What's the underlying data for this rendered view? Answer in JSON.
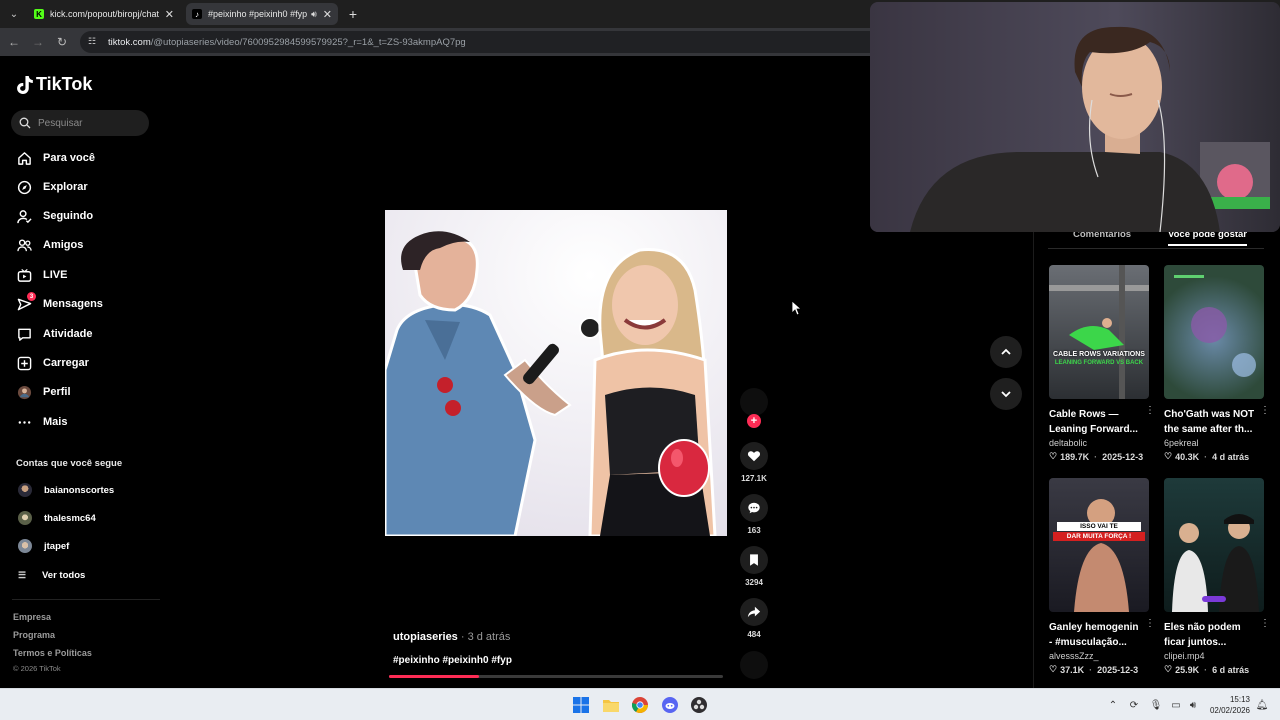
{
  "browser": {
    "tabs": [
      {
        "title": "kick.com/popout/biropj/chat",
        "active": false
      },
      {
        "title": "#peixinho #peixinh0 #fyp |",
        "active": true
      }
    ],
    "url_host": "tiktok.com",
    "url_path": "/@utopiaseries/video/7600952984599579925?_r=1&_t=ZS-93akmpAQ7pg"
  },
  "sidebar": {
    "logo": "TikTok",
    "search_placeholder": "Pesquisar",
    "nav": [
      {
        "label": "Para você",
        "icon": "home-icon"
      },
      {
        "label": "Explorar",
        "icon": "compass-icon"
      },
      {
        "label": "Seguindo",
        "icon": "person-check-icon"
      },
      {
        "label": "Amigos",
        "icon": "friends-icon"
      },
      {
        "label": "LIVE",
        "icon": "live-tv-icon"
      },
      {
        "label": "Mensagens",
        "icon": "send-icon",
        "badge": "3"
      },
      {
        "label": "Atividade",
        "icon": "message-box-icon"
      },
      {
        "label": "Carregar",
        "icon": "upload-plus-icon"
      },
      {
        "label": "Perfil",
        "icon": "avatar-icon"
      },
      {
        "label": "Mais",
        "icon": "more-dots-icon"
      }
    ],
    "following_title": "Contas que você segue",
    "following": [
      "baianonscortes",
      "thalesmc64",
      "jtapef"
    ],
    "see_all": "Ver todos",
    "footer": [
      "Empresa",
      "Programa",
      "Termos e Políticas"
    ],
    "copyright": "© 2026 TikTok"
  },
  "video": {
    "author": "utopiaseries",
    "posted": " · 3 d atrás",
    "caption": "#peixinho #peixinh0 #fyp",
    "progress": 0.27,
    "likes": "127.1K",
    "comments": "163",
    "saves": "3294",
    "shares": "484"
  },
  "panel": {
    "tab_comments": "Comentários",
    "tab_suggested": "Você pode gostar",
    "cards": [
      {
        "title": "Cable Rows — Leaning Forward...",
        "author": "deltabolic",
        "likes": "189.7K",
        "date": "2025-12-3",
        "overlay": "CABLE ROWS VARIATIONS",
        "overlay2": "LEANING FORWARD VS BACK"
      },
      {
        "title": "Cho'Gath was NOT the same after th...",
        "author": "6pekreal",
        "likes": "40.3K",
        "date": "4 d atrás"
      },
      {
        "title": "Ganley hemogenin - #musculação...",
        "author": "alvesssZzz_",
        "likes": "37.1K",
        "date": "2025-12-3",
        "overlay": "ISSO VAI TE",
        "overlay2": "DAR MUITA FORÇA !"
      },
      {
        "title": "Eles não podem ficar juntos...",
        "author": "clipei.mp4",
        "likes": "25.9K",
        "date": "6 d atrás"
      }
    ]
  },
  "taskbar": {
    "time": "15:13",
    "date": "02/02/2026"
  },
  "colors": {
    "accent": "#fe2c55",
    "background": "#000000"
  }
}
